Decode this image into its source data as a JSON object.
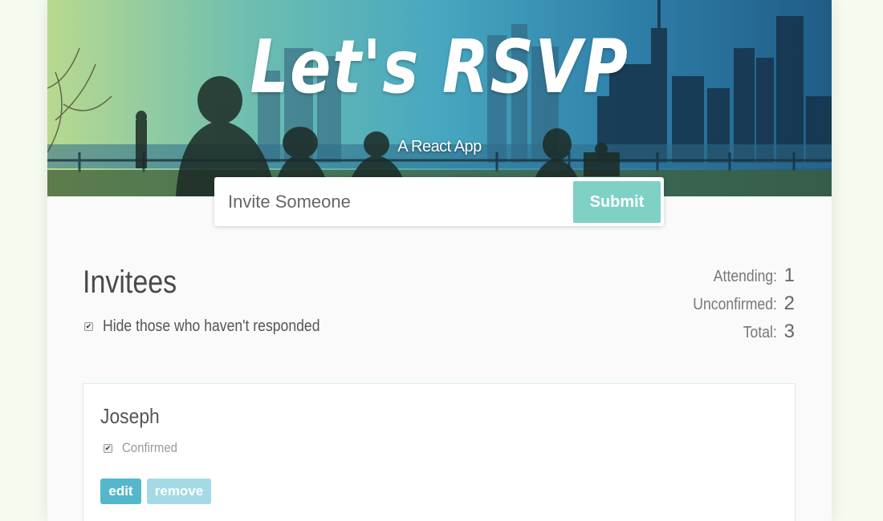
{
  "header": {
    "title": "Let's RSVP",
    "subtitle": "A React App"
  },
  "invite_form": {
    "placeholder": "Invite Someone",
    "submit_label": "Submit"
  },
  "invitees": {
    "title": "Invitees",
    "hide_unresponded_label": "Hide those who haven't responded",
    "hide_unresponded_checked": true
  },
  "counter": {
    "attending_label": "Attending:",
    "attending_value": "1",
    "unconfirmed_label": "Unconfirmed:",
    "unconfirmed_value": "2",
    "total_label": "Total:",
    "total_value": "3"
  },
  "guests": [
    {
      "name": "Joseph",
      "confirmed_label": "Confirmed",
      "confirmed": true,
      "edit_label": "edit",
      "remove_label": "remove"
    }
  ],
  "colors": {
    "submit": "#7fd1c5",
    "edit": "#55b7cc",
    "remove": "#a3dae5",
    "page_bg": "#f6fbf0"
  }
}
